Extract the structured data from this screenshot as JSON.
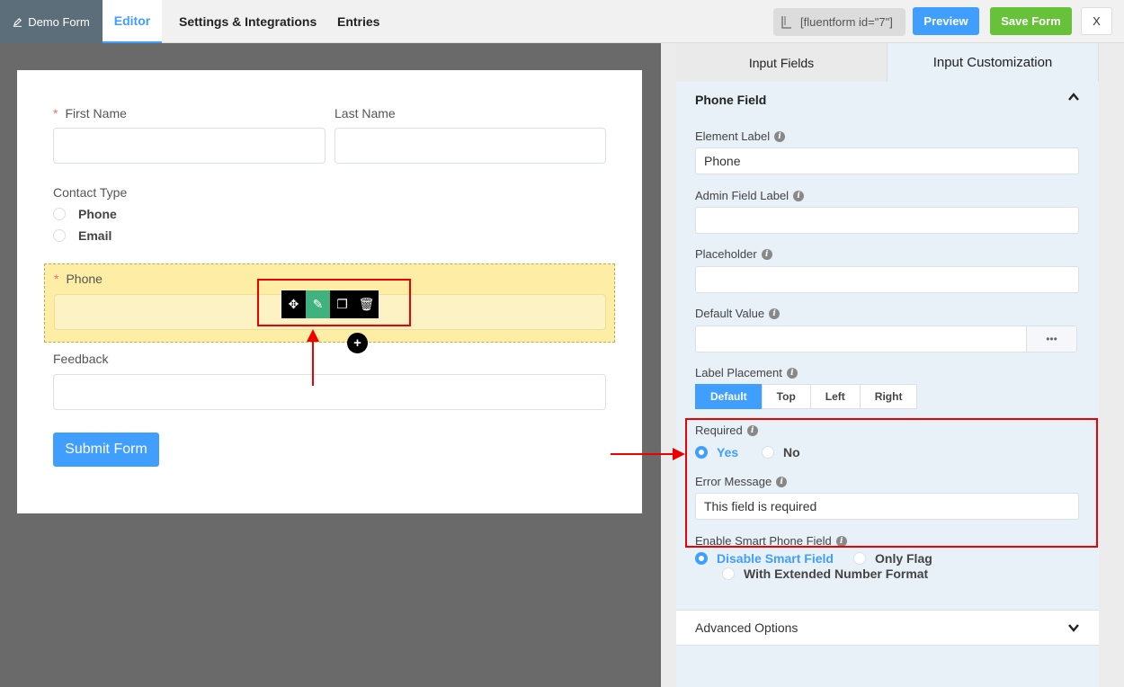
{
  "topbar": {
    "brand": "Demo Form",
    "tabs": [
      "Editor",
      "Settings & Integrations",
      "Entries"
    ],
    "shortcode": "[fluentform id=\"7\"]",
    "preview": "Preview",
    "save": "Save Form",
    "close": "X"
  },
  "form": {
    "first_name": "First Name",
    "last_name": "Last Name",
    "contact_type": "Contact Type",
    "contact_options": [
      "Phone",
      "Email"
    ],
    "phone": "Phone",
    "feedback": "Feedback",
    "submit": "Submit Form"
  },
  "panel": {
    "tabs": [
      "Input Fields",
      "Input Customization"
    ],
    "section": "Phone Field",
    "element_label": "Element Label",
    "element_label_value": "Phone",
    "admin_label": "Admin Field Label",
    "placeholder": "Placeholder",
    "default_value": "Default Value",
    "dots": "•••",
    "label_placement": "Label Placement",
    "placements": [
      "Default",
      "Top",
      "Left",
      "Right"
    ],
    "required": "Required",
    "required_yes": "Yes",
    "required_no": "No",
    "error_message": "Error Message",
    "error_message_value": "This field is required",
    "smart_phone": "Enable Smart Phone Field",
    "smart_opts": [
      "Disable Smart Field",
      "Only Flag",
      "With Extended Number Format"
    ],
    "advanced": "Advanced Options"
  },
  "colors": {
    "accent": "#409eff",
    "save": "#67c23a",
    "annotation": "#e00000"
  }
}
